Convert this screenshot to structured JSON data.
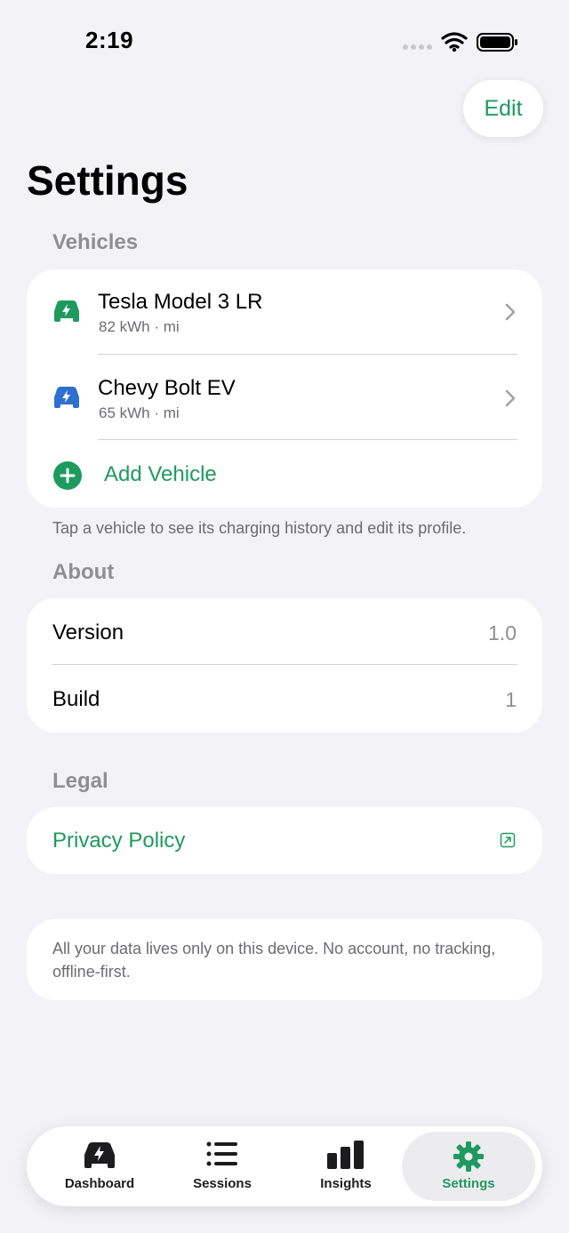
{
  "status_bar": {
    "time": "2:19"
  },
  "header": {
    "edit_label": "Edit",
    "title": "Settings"
  },
  "vehicles": {
    "section_title": "Vehicles",
    "items": [
      {
        "name": "Tesla Model 3 LR",
        "detail": "82 kWh · mi",
        "icon": "car-charging-icon",
        "color": "#1f9a5f"
      },
      {
        "name": "Chevy Bolt EV",
        "detail": "65 kWh · mi",
        "icon": "car-charging-icon",
        "color": "#2f6fcf"
      }
    ],
    "add_label": "Add Vehicle",
    "footnote": "Tap a vehicle to see its charging history and edit its profile."
  },
  "about": {
    "section_title": "About",
    "rows": [
      {
        "label": "Version",
        "value": "1.0"
      },
      {
        "label": "Build",
        "value": "1"
      }
    ]
  },
  "legal": {
    "section_title": "Legal",
    "privacy_label": "Privacy Policy",
    "icon": "external-link-icon"
  },
  "info": {
    "text": "All your data lives only on this device. No account, no tracking, offline-first."
  },
  "tabbar": {
    "tabs": [
      {
        "label": "Dashboard",
        "icon": "car-charging-icon"
      },
      {
        "label": "Sessions",
        "icon": "list-icon"
      },
      {
        "label": "Insights",
        "icon": "bar-chart-icon"
      },
      {
        "label": "Settings",
        "icon": "gear-icon",
        "active": true
      }
    ]
  },
  "colors": {
    "accent": "#1f9a5f",
    "background": "#f2f2f7"
  }
}
